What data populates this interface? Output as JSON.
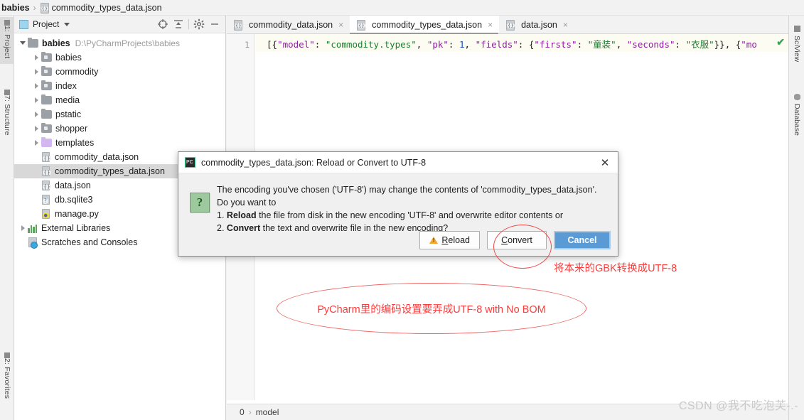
{
  "breadcrumb": {
    "root": "babies",
    "separator": "›",
    "leaf": "commodity_types_data.json",
    "leaf_icon": "json-file-icon"
  },
  "left_tool_strip": {
    "tabs": [
      {
        "label": "1: Project",
        "selected": true
      },
      {
        "label": "7: Structure",
        "selected": false
      },
      {
        "label": "2: Favorites",
        "selected": false
      }
    ]
  },
  "right_tool_strip": {
    "tabs": [
      {
        "label": "SciView",
        "icon": "grid-icon"
      },
      {
        "label": "Database",
        "icon": "database-icon"
      }
    ]
  },
  "project_panel": {
    "title": "Project",
    "caret_icon": "chevron-down-icon",
    "toolbar": [
      {
        "name": "locate-icon",
        "title": "Select Opened File"
      },
      {
        "name": "collapse-all-icon",
        "title": "Collapse All"
      },
      {
        "name": "gear-icon",
        "title": "Settings"
      },
      {
        "name": "minimize-icon",
        "title": "Hide"
      }
    ],
    "tree": [
      {
        "label": "babies",
        "path": "D:\\PyCharmProjects\\babies",
        "indent": 0,
        "arrow": "down",
        "icon": "folder-grey",
        "bold": true,
        "selected": false
      },
      {
        "label": "babies",
        "path": "",
        "indent": 1,
        "arrow": "right",
        "icon": "folder-module",
        "bold": false,
        "selected": false
      },
      {
        "label": "commodity",
        "path": "",
        "indent": 1,
        "arrow": "right",
        "icon": "folder-module",
        "bold": false,
        "selected": false
      },
      {
        "label": "index",
        "path": "",
        "indent": 1,
        "arrow": "right",
        "icon": "folder-module",
        "bold": false,
        "selected": false
      },
      {
        "label": "media",
        "path": "",
        "indent": 1,
        "arrow": "right",
        "icon": "folder-grey",
        "bold": false,
        "selected": false
      },
      {
        "label": "pstatic",
        "path": "",
        "indent": 1,
        "arrow": "right",
        "icon": "folder-grey",
        "bold": false,
        "selected": false
      },
      {
        "label": "shopper",
        "path": "",
        "indent": 1,
        "arrow": "right",
        "icon": "folder-module",
        "bold": false,
        "selected": false
      },
      {
        "label": "templates",
        "path": "",
        "indent": 1,
        "arrow": "right",
        "icon": "folder-violet",
        "bold": false,
        "selected": false
      },
      {
        "label": "commodity_data.json",
        "path": "",
        "indent": 1,
        "arrow": "none",
        "icon": "json-file",
        "bold": false,
        "selected": false
      },
      {
        "label": "commodity_types_data.json",
        "path": "",
        "indent": 1,
        "arrow": "none",
        "icon": "json-file",
        "bold": false,
        "selected": true
      },
      {
        "label": "data.json",
        "path": "",
        "indent": 1,
        "arrow": "none",
        "icon": "json-file",
        "bold": false,
        "selected": false
      },
      {
        "label": "db.sqlite3",
        "path": "",
        "indent": 1,
        "arrow": "none",
        "icon": "sqlite-file",
        "bold": false,
        "selected": false
      },
      {
        "label": "manage.py",
        "path": "",
        "indent": 1,
        "arrow": "none",
        "icon": "python-file",
        "bold": false,
        "selected": false
      },
      {
        "label": "External Libraries",
        "path": "",
        "indent": 0,
        "arrow": "right",
        "icon": "library-icon",
        "bold": false,
        "selected": false
      },
      {
        "label": "Scratches and Consoles",
        "path": "",
        "indent": 0,
        "arrow": "none",
        "icon": "scratches-icon",
        "bold": false,
        "selected": false
      }
    ]
  },
  "editor": {
    "tabs": [
      {
        "label": "commodity_data.json",
        "active": false,
        "close_icon": "×"
      },
      {
        "label": "commodity_types_data.json",
        "active": true,
        "close_icon": "×"
      },
      {
        "label": "data.json",
        "active": false,
        "close_icon": "×"
      }
    ],
    "line_number": "1",
    "code_tokens": [
      {
        "text": "[{",
        "type": "punc"
      },
      {
        "text": "\"model\"",
        "type": "key"
      },
      {
        "text": ": ",
        "type": "punc"
      },
      {
        "text": "\"commodity.types\"",
        "type": "str"
      },
      {
        "text": ", ",
        "type": "punc"
      },
      {
        "text": "\"pk\"",
        "type": "key"
      },
      {
        "text": ": ",
        "type": "punc"
      },
      {
        "text": "1",
        "type": "num"
      },
      {
        "text": ", ",
        "type": "punc"
      },
      {
        "text": "\"fields\"",
        "type": "key"
      },
      {
        "text": ": {",
        "type": "punc"
      },
      {
        "text": "\"firsts\"",
        "type": "key"
      },
      {
        "text": ": ",
        "type": "punc"
      },
      {
        "text": "\"童装\"",
        "type": "str"
      },
      {
        "text": ", ",
        "type": "punc"
      },
      {
        "text": "\"seconds\"",
        "type": "key"
      },
      {
        "text": ": ",
        "type": "punc"
      },
      {
        "text": "\"衣服\"",
        "type": "str"
      },
      {
        "text": "}}, {",
        "type": "punc"
      },
      {
        "text": "\"mo",
        "type": "key"
      }
    ],
    "inspection_status_icon": "green-check-icon",
    "status_breadcrumb": [
      "0",
      "›",
      "model"
    ]
  },
  "dialog": {
    "app_icon": "pycharm-icon",
    "title": "commodity_types_data.json: Reload or Convert to UTF-8",
    "close_icon": "✕",
    "question_icon": "question-icon",
    "message_lines": [
      "The encoding you've chosen ('UTF-8') may change the contents of 'commodity_types_data.json'.",
      "Do you want to"
    ],
    "numbered": [
      {
        "num": "1.",
        "bold": "Reload",
        "rest": " the file from disk in the new encoding 'UTF-8' and overwrite editor contents or"
      },
      {
        "num": "2.",
        "bold": "Convert",
        "rest": " the text and overwrite file in the new encoding?"
      }
    ],
    "buttons": [
      {
        "label": "Reload",
        "mnemonic": "R",
        "icon": "warning-icon",
        "primary": false
      },
      {
        "label": "Convert",
        "mnemonic": "C",
        "icon": "",
        "primary": false
      },
      {
        "label": "Cancel",
        "mnemonic": "",
        "icon": "",
        "primary": true
      }
    ]
  },
  "annotations": {
    "circle_target": "Convert",
    "note_gbk": "将本来的GBK转换成UTF-8",
    "note_ellipse": "PyCharm里的编码设置要弄成UTF-8 with No BOM",
    "color": "#fa3c3c"
  },
  "watermark": {
    "text": "CSDN @我不吃泡芙-.-"
  }
}
